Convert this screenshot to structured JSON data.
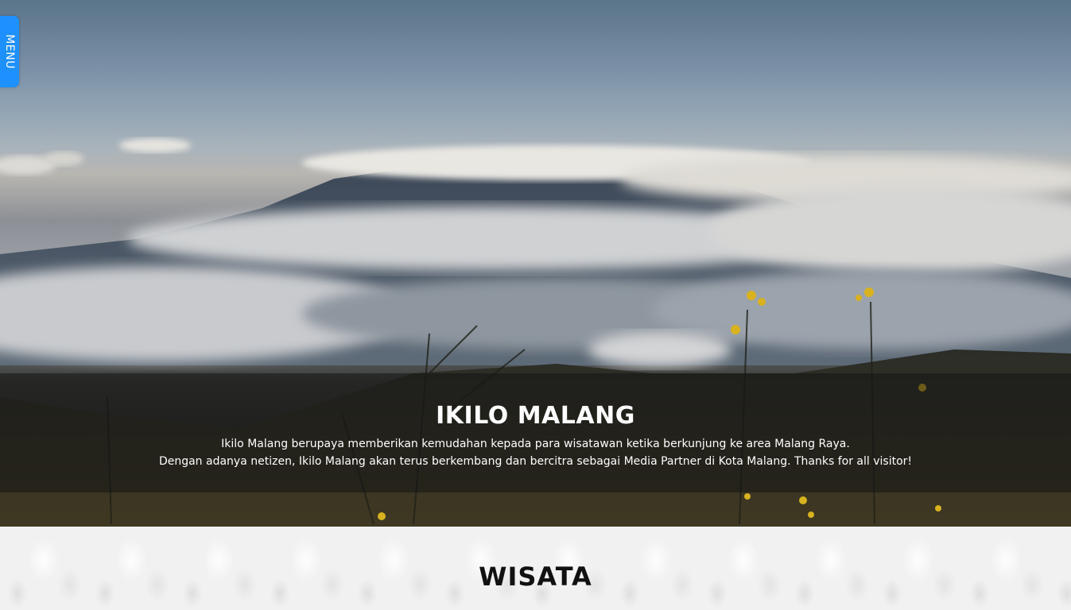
{
  "menu": {
    "label": "MENU"
  },
  "hero": {
    "title": "IKILO MALANG",
    "description_line1": "Ikilo Malang berupaya memberikan kemudahan kepada para wisatawan ketika berkunjung ke area Malang Raya.",
    "description_line2": "Dengan adanya netizen, Ikilo Malang akan terus berkembang dan bercitra sebagai Media Partner di Kota Malang. Thanks for all visitor!",
    "background_image": "mountain-above-clouds-landscape"
  },
  "section": {
    "title": "WISATA"
  },
  "colors": {
    "menu_accent": "#1e90ff",
    "caption_band": "rgba(20,20,20,0.55)",
    "section_background": "#f1f1f1",
    "section_title": "#111111"
  },
  "icons": {
    "menu_tab": "vertical-menu-tab"
  }
}
